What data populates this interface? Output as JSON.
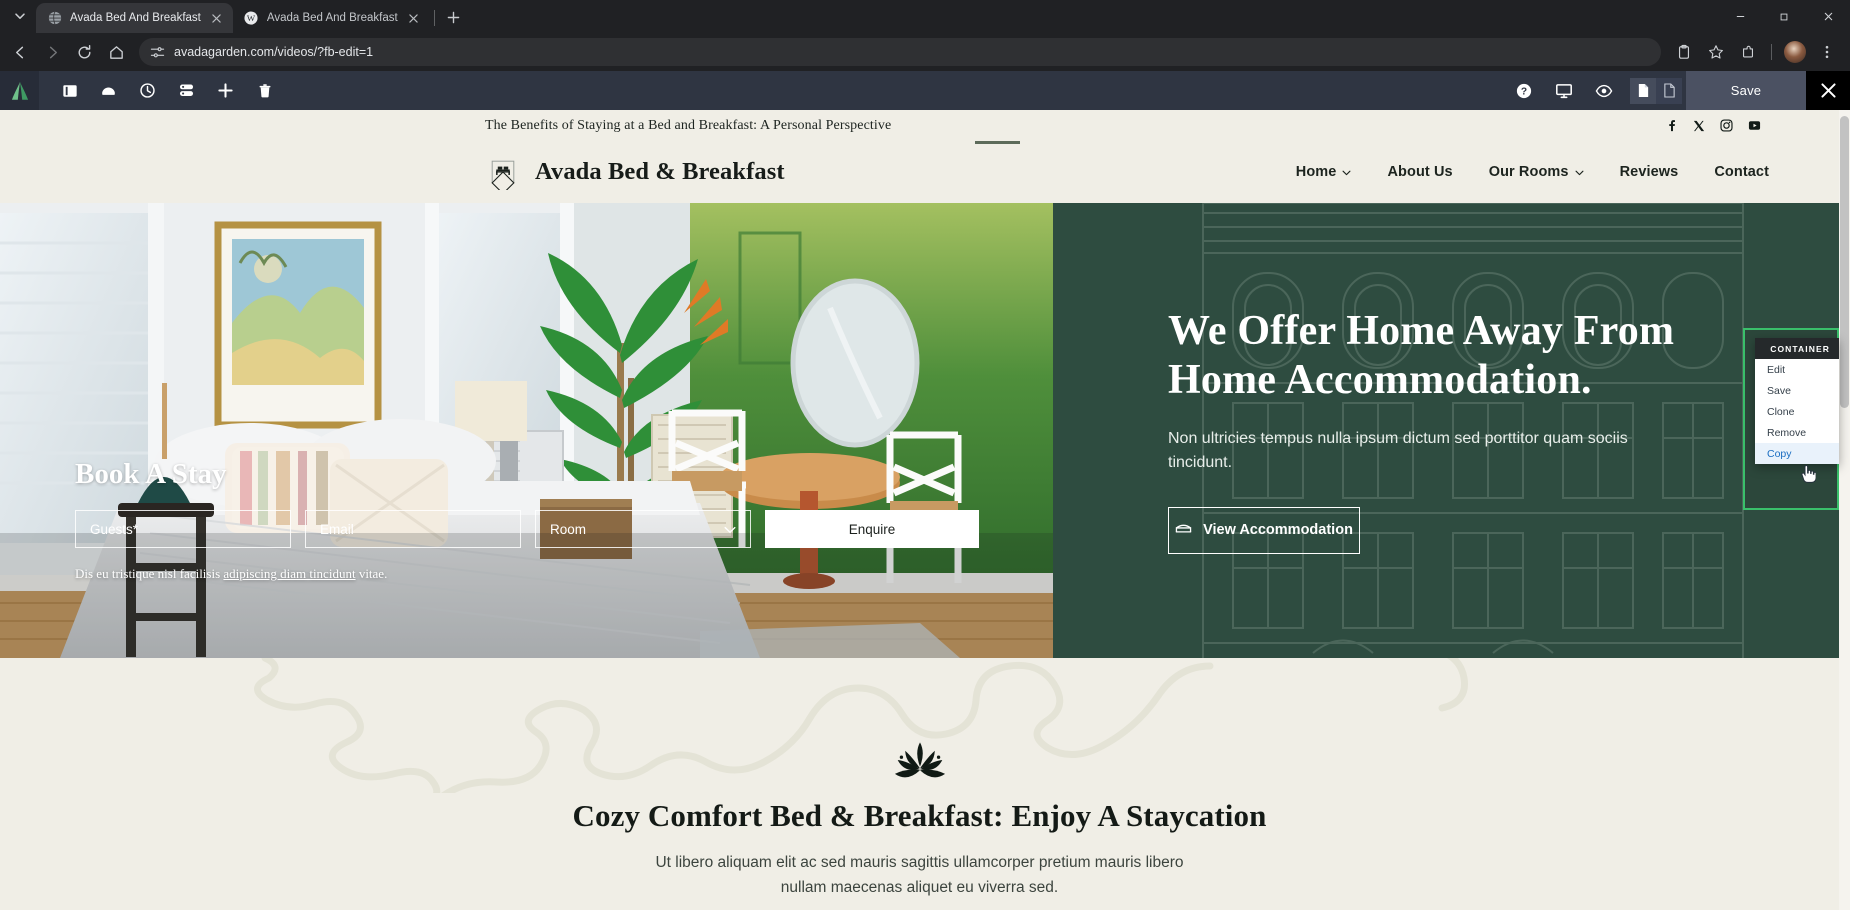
{
  "browser": {
    "tabs": [
      {
        "title": "Avada Bed And Breakfast",
        "favicon": "globe-icon",
        "active": true
      },
      {
        "title": "Avada Bed And Breakfast",
        "favicon": "wordpress-icon",
        "active": false
      }
    ],
    "tab_list_button": "tab-search-icon",
    "new_tab_button": "+",
    "window_controls": {
      "minimize": "—",
      "maximize": "□",
      "close": "✕"
    },
    "nav": {
      "back": "back-icon",
      "forward": "forward-icon",
      "reload": "reload-icon",
      "home": "home-icon"
    },
    "url": "avadagarden.com/videos/?fb-edit=1",
    "url_site_settings_icon": "tune-icon",
    "right_icons": [
      "clipboard-icon",
      "bookmark-star-icon",
      "extensions-icon",
      "profile-avatar",
      "more-menu-icon"
    ]
  },
  "builder_toolbar": {
    "logo": "avada-logo",
    "left_tools": [
      {
        "name": "layout-panel-icon",
        "label": "Layout"
      },
      {
        "name": "save-library-icon",
        "label": "Library"
      },
      {
        "name": "history-clock-icon",
        "label": "History"
      },
      {
        "name": "layers-icon",
        "label": "Layers"
      },
      {
        "name": "add-plus-icon",
        "label": "Add Element"
      },
      {
        "name": "trash-icon",
        "label": "Delete"
      }
    ],
    "right_tools": [
      {
        "name": "help-question-icon",
        "label": "Help"
      },
      {
        "name": "responsive-monitor-icon",
        "label": "Responsive"
      },
      {
        "name": "preview-eye-icon",
        "label": "Preview"
      }
    ],
    "doc_toggle": [
      {
        "name": "page-filled-icon",
        "active": true
      },
      {
        "name": "page-outline-icon",
        "active": false
      }
    ],
    "save_label": "Save",
    "close_label": "✕"
  },
  "site": {
    "topbar": {
      "headline": "The Benefits of Staying at a Bed and Breakfast: A Personal Perspective",
      "social": [
        {
          "name": "facebook-icon",
          "glyph": "f"
        },
        {
          "name": "x-twitter-icon",
          "glyph": "X"
        },
        {
          "name": "instagram-icon",
          "glyph": "▢"
        },
        {
          "name": "youtube-icon",
          "glyph": "▶"
        }
      ]
    },
    "header": {
      "logo_icon": "bed-diamond-logo",
      "brand": "Avada Bed & Breakfast",
      "nav": [
        {
          "label": "Home",
          "has_dropdown": true,
          "active": true
        },
        {
          "label": "About Us",
          "has_dropdown": false,
          "active": false
        },
        {
          "label": "Our Rooms",
          "has_dropdown": true,
          "active": false
        },
        {
          "label": "Reviews",
          "has_dropdown": false,
          "active": false
        },
        {
          "label": "Contact",
          "has_dropdown": false,
          "active": false
        }
      ]
    },
    "hero": {
      "heading": "We Offer Home Away From Home Accommodation.",
      "paragraph": "Non ultricies tempus nulla ipsum dictum sed porttitor quam sociis tincidunt.",
      "button_label": "View Accommodation",
      "button_icon": "bed-outline-icon",
      "panel_color": "#2e4c40",
      "booking": {
        "title": "Book A Stay",
        "guests_placeholder": "Guests*",
        "email_placeholder": "Email",
        "room_placeholder": "Room",
        "room_caret": "chevron-down-icon",
        "submit_label": "Enquire",
        "note_prefix": "Dis eu tristique nisl facilisis ",
        "note_link": "adipiscing diam tincidunt",
        "note_suffix": " vitae."
      }
    },
    "lower": {
      "icon": "lotus-icon",
      "heading": "Cozy Comfort Bed & Breakfast: Enjoy A Staycation",
      "paragraph": "Ut libero aliquam elit ac sed mauris sagittis ullamcorper pretium mauris libero nullam maecenas aliquet eu viverra sed."
    }
  },
  "context_menu": {
    "title": "CONTAINER",
    "items": [
      {
        "label": "Edit",
        "highlighted": false
      },
      {
        "label": "Save",
        "highlighted": false
      },
      {
        "label": "Clone",
        "highlighted": false
      },
      {
        "label": "Remove",
        "highlighted": false
      },
      {
        "label": "Copy",
        "highlighted": true
      }
    ],
    "selection_outline_color": "#3ac06b",
    "highlight_color": "#e9f2fb"
  }
}
